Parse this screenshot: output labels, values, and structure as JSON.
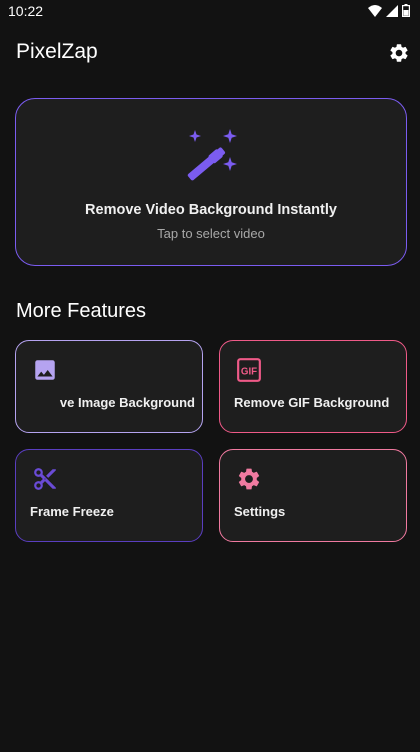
{
  "status_bar": {
    "time": "10:22",
    "icons": [
      "wifi-icon",
      "signal-icon",
      "battery-icon"
    ]
  },
  "app_bar": {
    "title": "PixelZap",
    "settings_icon": "gear-icon"
  },
  "hero": {
    "icon": "magic-wand-icon",
    "title": "Remove Video Background Instantly",
    "subtitle": "Tap to select video",
    "border_color": "#7b5cf0"
  },
  "features": {
    "title": "More Features",
    "items": [
      {
        "label": "Remove Image Background",
        "visible_label": "ve Image Background",
        "icon": "image-icon",
        "accent": "#b5a3f0"
      },
      {
        "label": "Remove GIF Background",
        "icon": "gif-icon",
        "accent": "#ef5a88"
      },
      {
        "label": "Frame Freeze",
        "icon": "scissors-icon",
        "accent": "#6a4bd6"
      },
      {
        "label": "Settings",
        "icon": "gear-icon",
        "accent": "#f07aa0"
      }
    ]
  },
  "colors": {
    "background": "#121212",
    "card": "#1e1e1e",
    "primary": "#7b5cf0",
    "secondary": "#ef5a88"
  }
}
